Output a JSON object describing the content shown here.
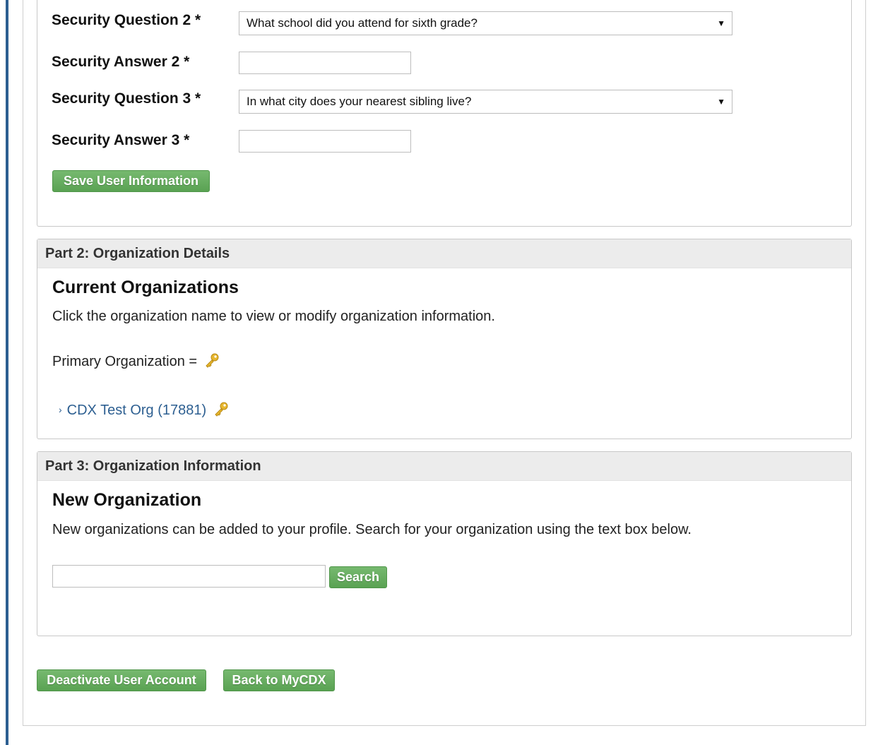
{
  "security": {
    "question2_label": "Security Question 2 *",
    "question2_value": "What school did you attend for sixth grade?",
    "answer2_label": "Security Answer 2 *",
    "answer2_value": "",
    "question3_label": "Security Question 3 *",
    "question3_value": "In what city does your nearest sibling live?",
    "answer3_label": "Security Answer 3 *",
    "answer3_value": "",
    "save_button": "Save User Information"
  },
  "part2": {
    "header": "Part 2: Organization Details",
    "title": "Current Organizations",
    "description": "Click the organization name to view or modify organization information.",
    "primary_label": "Primary Organization =",
    "primary_icon": "key-icon",
    "organizations": [
      {
        "chevron": "›",
        "name": "CDX Test Org (17881)",
        "icon": "key-icon"
      }
    ]
  },
  "part3": {
    "header": "Part 3: Organization Information",
    "title": "New Organization",
    "description": "New organizations can be added to your profile. Search for your organization using the text box below.",
    "search_value": "",
    "search_button": "Search"
  },
  "footer": {
    "deactivate_button": "Deactivate User Account",
    "back_button": "Back to MyCDX"
  },
  "colors": {
    "accent_blue": "#2d5f91",
    "button_green": "#5aa253",
    "panel_header_bg": "#ececec",
    "key_gold": "#e7b72f"
  }
}
